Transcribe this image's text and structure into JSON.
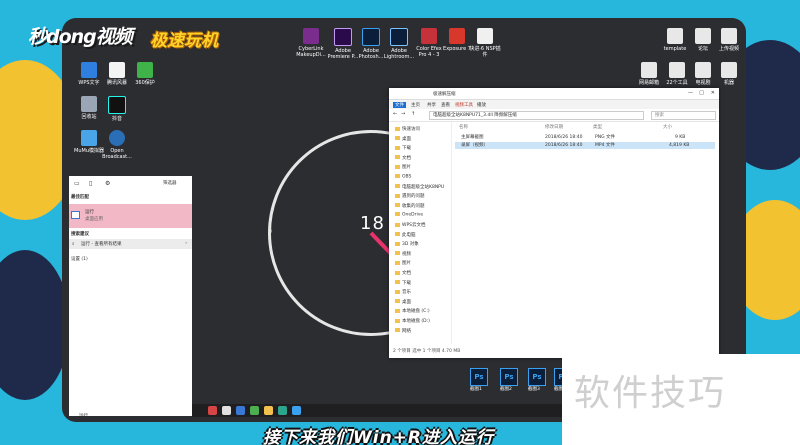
{
  "branding": {
    "logo_main": "秒dong视频",
    "logo_sub": "极速玩机"
  },
  "subtitle": "接下来我们Win+R进入运行",
  "watermark": "软件技巧",
  "desktop_icons_top": [
    {
      "label": "CyberLink MakeupDi..."
    },
    {
      "label": "Adobe Premiere P..."
    },
    {
      "label": "Adobe Photosh..."
    },
    {
      "label": "Adobe Lightroom..."
    },
    {
      "label": "Color Efex Pro 4 - 3"
    },
    {
      "label": "Exposure 7"
    },
    {
      "label": "快进·6 NSP插件"
    }
  ],
  "desktop_icons_left": [
    {
      "label": "WPS文字"
    },
    {
      "label": "腾讯风暴"
    },
    {
      "label": "360保护"
    },
    {
      "label": "回收站"
    },
    {
      "label": "抖音"
    },
    {
      "label": "MuMu模拟器"
    },
    {
      "label": "Open Broadcast..."
    }
  ],
  "desktop_icons_right": [
    {
      "label": "template"
    },
    {
      "label": "论坛"
    },
    {
      "label": "上传视频"
    },
    {
      "label": "网易邮箱"
    },
    {
      "label": "22个工具"
    },
    {
      "label": "电视剧"
    },
    {
      "label": "机器"
    }
  ],
  "clock": {
    "time": "18 :"
  },
  "explorer": {
    "ribbon_tabs": [
      "文件",
      "主页",
      "共享",
      "查看",
      "视频工具",
      "播放"
    ],
    "title": "极速解压缩",
    "address": "电脑超级全站K8NPU71_3.dll 降频解压缩",
    "search_placeholder": "搜索",
    "columns": [
      "名称",
      "修改日期",
      "类型",
      "大小"
    ],
    "files": [
      {
        "name": "主屏幕截图",
        "date": "2018/6/26 18:40",
        "type": "PNG 文件",
        "size": "9 KB"
      },
      {
        "name": "录屏（视频）",
        "date": "2018/6/26 18:40",
        "type": "MP4 文件",
        "size": "4,819 KB"
      }
    ],
    "nav": [
      "快速访问",
      "桌面",
      "下载",
      "文档",
      "图片",
      "OBS",
      "电脑超级全站K8NPU",
      "遇到的问题",
      "收集的问题",
      "OneDrive",
      "WPS云文档",
      "此电脑",
      "3D 对象",
      "视频",
      "图片",
      "文档",
      "下载",
      "音乐",
      "桌面",
      "本地磁盘 (C:)",
      "本地磁盘 (D:)",
      "网络"
    ],
    "status": "2 个项目    选中 1 个项目  4.70 MB"
  },
  "start_menu": {
    "filter_label": "筛选器",
    "best_match_header": "最佳匹配",
    "best_match_title": "运行",
    "best_match_sub": "桌面应用",
    "search_suggest_header": "搜索建议",
    "search_suggest_item": "运行 - 查看所有结果",
    "settings_header": "设置 (1)",
    "search_text": "运行"
  },
  "ps_icons": [
    {
      "label": "截图1"
    },
    {
      "label": "截图2"
    },
    {
      "label": "截图3"
    },
    {
      "label": "截图4"
    }
  ],
  "colors": {
    "frame": "#27b6dc",
    "screen": "#2c2d31",
    "best_match": "#f3b8c6",
    "subtitle_text": "#ffffff"
  }
}
